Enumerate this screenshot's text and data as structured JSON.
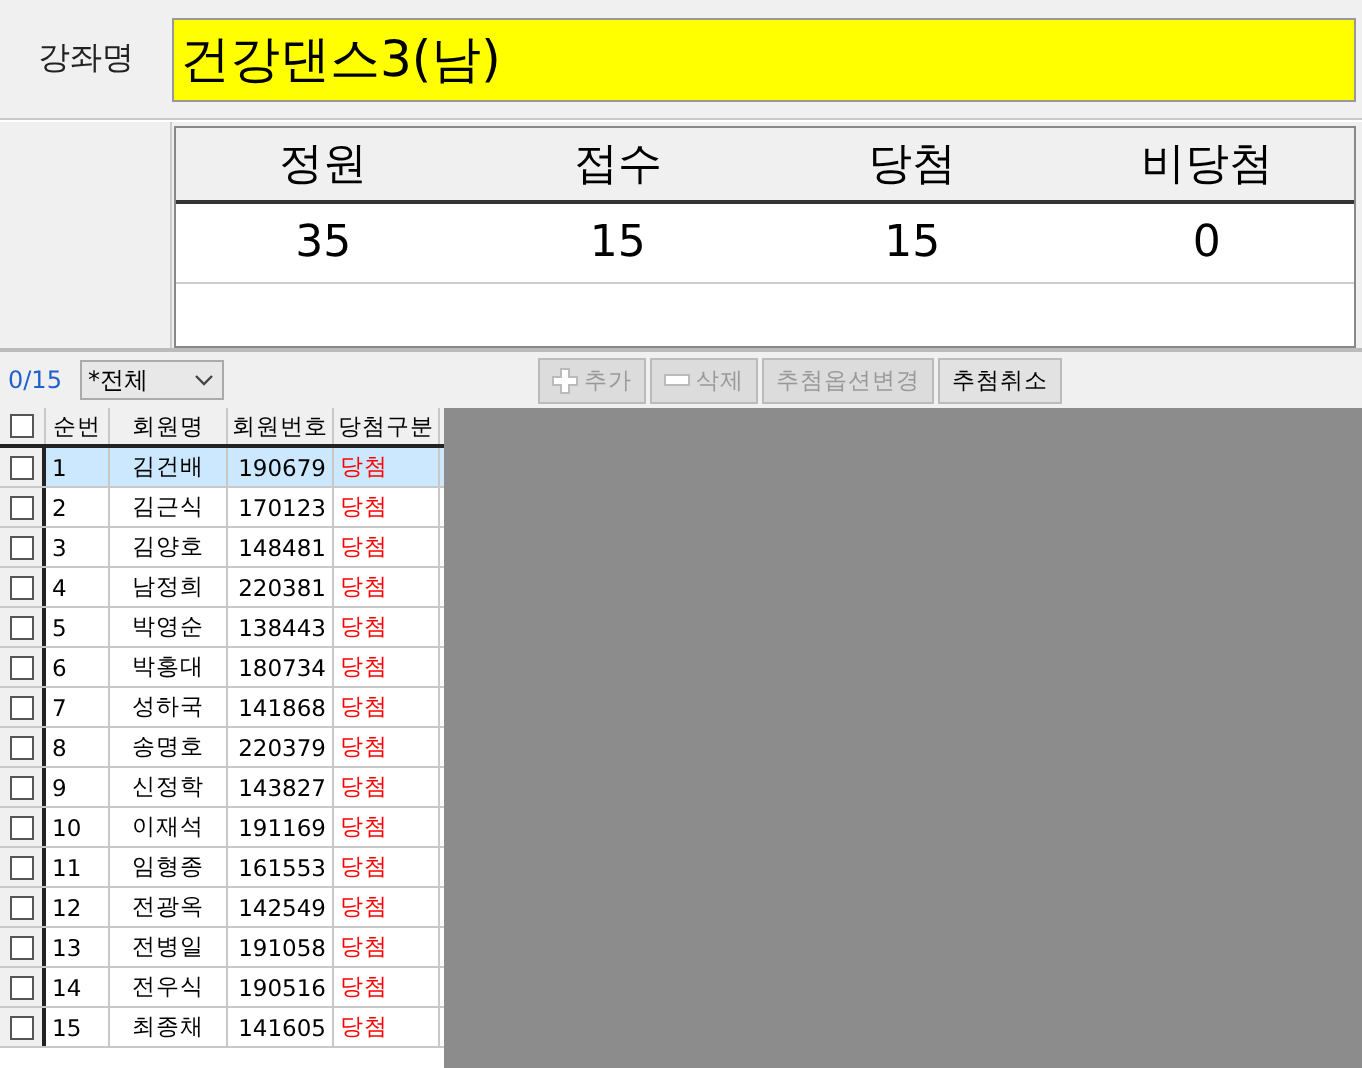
{
  "course": {
    "label": "강좌명",
    "value": "건강댄스3(남)"
  },
  "stats": {
    "columns": [
      "정원",
      "접수",
      "당첨",
      "비당첨"
    ],
    "values": [
      "35",
      "15",
      "15",
      "0"
    ]
  },
  "toolbar": {
    "count": "0/15",
    "filter": "*전체",
    "buttons": [
      {
        "label": "추가",
        "kind": "add",
        "disabled": true
      },
      {
        "label": "삭제",
        "kind": "remove",
        "disabled": true
      },
      {
        "label": "추첨옵션변경",
        "disabled": true
      },
      {
        "label": "추첨취소",
        "disabled": false
      }
    ]
  },
  "table": {
    "header_checked": false,
    "columns": [
      "순번",
      "회원명",
      "회원번호",
      "당첨구분"
    ],
    "rows": [
      {
        "checked": false,
        "selected": true,
        "no": "1",
        "name": "김건배",
        "id": "190679",
        "result": "당첨"
      },
      {
        "checked": false,
        "selected": false,
        "no": "2",
        "name": "김근식",
        "id": "170123",
        "result": "당첨"
      },
      {
        "checked": false,
        "selected": false,
        "no": "3",
        "name": "김양호",
        "id": "148481",
        "result": "당첨"
      },
      {
        "checked": false,
        "selected": false,
        "no": "4",
        "name": "남정희",
        "id": "220381",
        "result": "당첨"
      },
      {
        "checked": false,
        "selected": false,
        "no": "5",
        "name": "박영순",
        "id": "138443",
        "result": "당첨"
      },
      {
        "checked": false,
        "selected": false,
        "no": "6",
        "name": "박홍대",
        "id": "180734",
        "result": "당첨"
      },
      {
        "checked": false,
        "selected": false,
        "no": "7",
        "name": "성하국",
        "id": "141868",
        "result": "당첨"
      },
      {
        "checked": false,
        "selected": false,
        "no": "8",
        "name": "송명호",
        "id": "220379",
        "result": "당첨"
      },
      {
        "checked": false,
        "selected": false,
        "no": "9",
        "name": "신정학",
        "id": "143827",
        "result": "당첨"
      },
      {
        "checked": false,
        "selected": false,
        "no": "10",
        "name": "이재석",
        "id": "191169",
        "result": "당첨"
      },
      {
        "checked": false,
        "selected": false,
        "no": "11",
        "name": "임형종",
        "id": "161553",
        "result": "당첨"
      },
      {
        "checked": false,
        "selected": false,
        "no": "12",
        "name": "전광옥",
        "id": "142549",
        "result": "당첨"
      },
      {
        "checked": false,
        "selected": false,
        "no": "13",
        "name": "전병일",
        "id": "191058",
        "result": "당첨"
      },
      {
        "checked": false,
        "selected": false,
        "no": "14",
        "name": "전우식",
        "id": "190516",
        "result": "당첨"
      },
      {
        "checked": false,
        "selected": false,
        "no": "15",
        "name": "최종채",
        "id": "141605",
        "result": "당첨"
      }
    ]
  }
}
